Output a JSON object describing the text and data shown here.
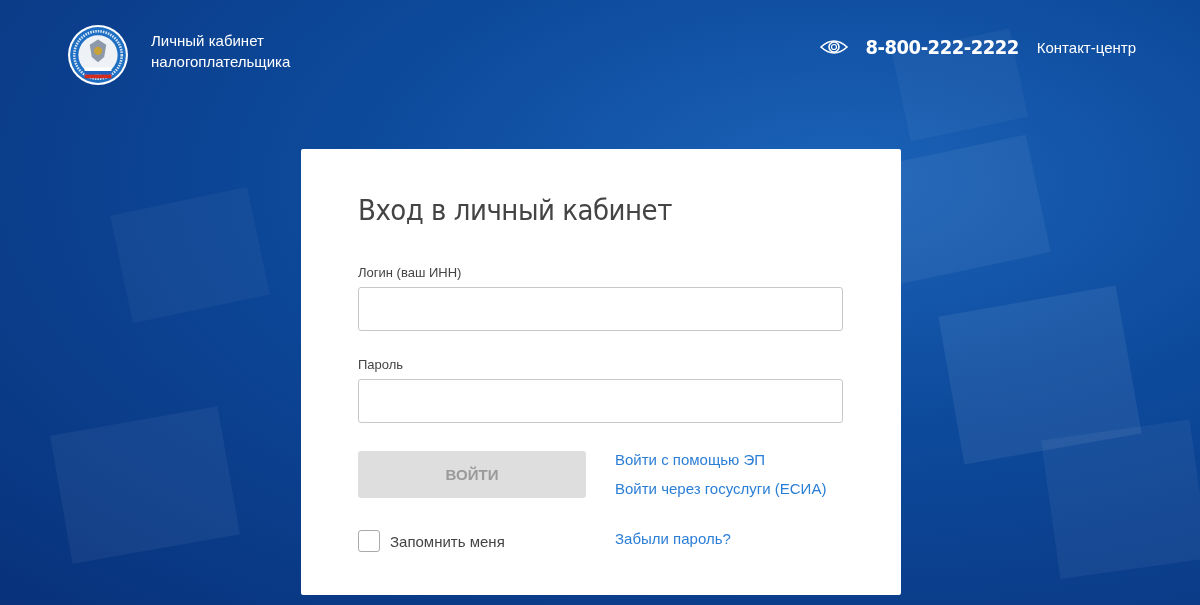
{
  "header": {
    "title_lines": [
      "Личный кабинет",
      "налогоплательщика"
    ],
    "phone": "8-800-222-2222",
    "contact_link": "Контакт-центр"
  },
  "form": {
    "title": "Вход в личный кабинет",
    "fields": [
      {
        "label": "Логин (ваш ИНН)"
      },
      {
        "label": "Пароль"
      }
    ],
    "submit": {
      "label": "ВОЙТИ",
      "disabled": true
    },
    "links": [
      "Войти с помощью ЭП",
      "Войти через госуслуги (ЕСИА)"
    ],
    "remember": {
      "label": "Запомнить меня",
      "checked": false
    },
    "forgot_link": "Забыли пароль?"
  }
}
